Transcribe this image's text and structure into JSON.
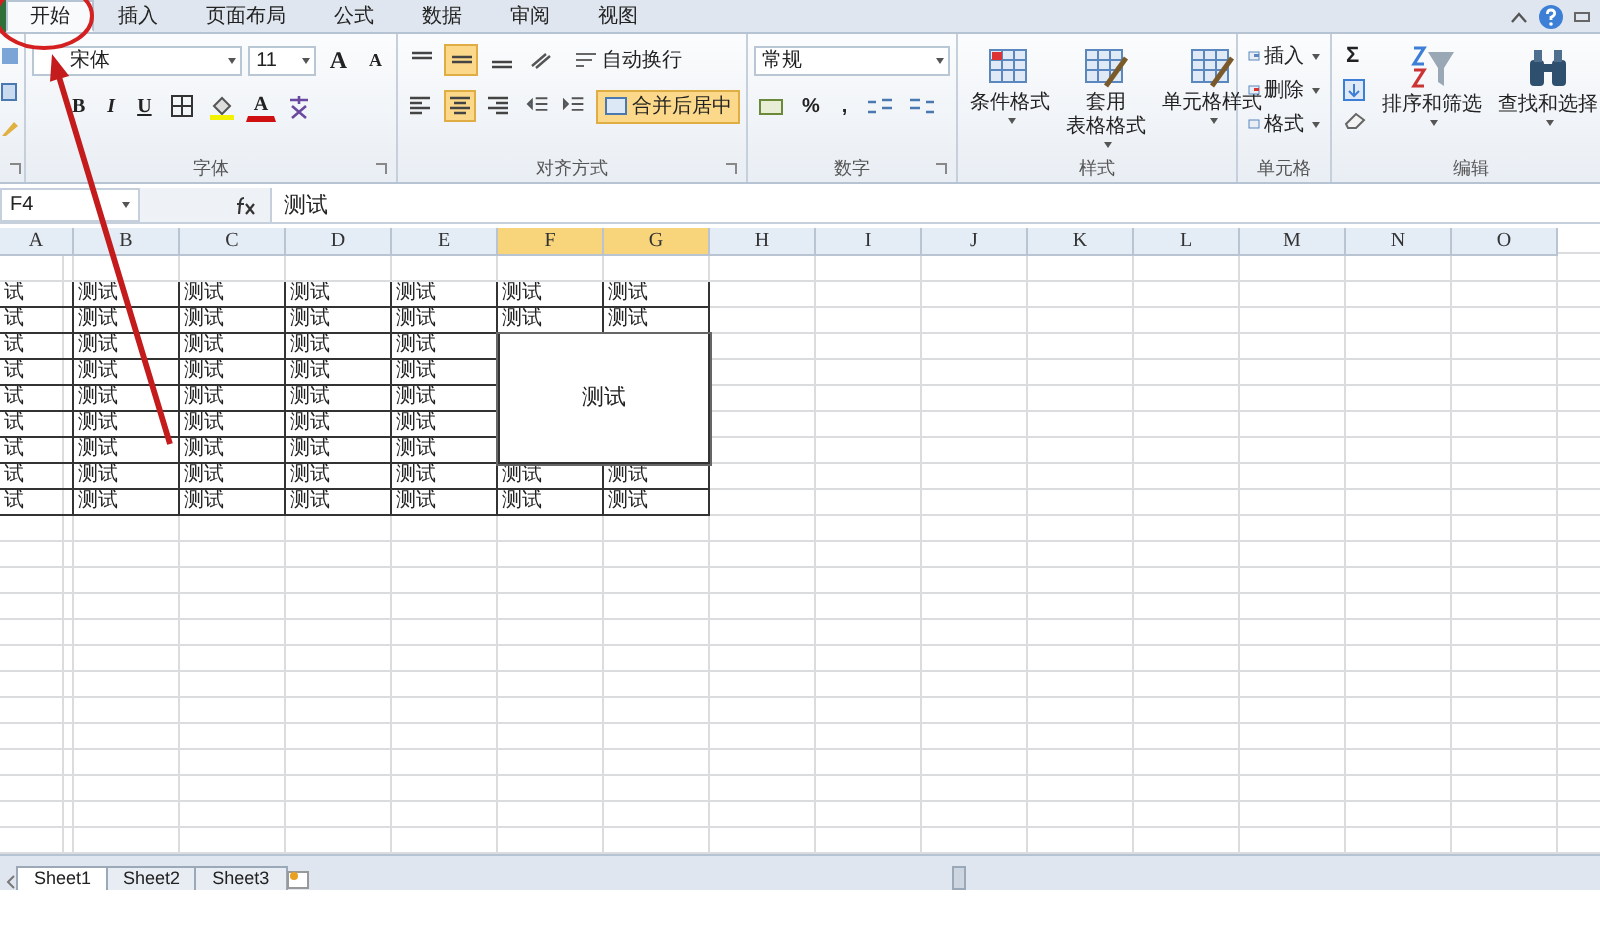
{
  "tabs": [
    {
      "label": "开始",
      "selected": true
    },
    {
      "label": "插入",
      "selected": false
    },
    {
      "label": "页面布局",
      "selected": false
    },
    {
      "label": "公式",
      "selected": false
    },
    {
      "label": "数据",
      "selected": false
    },
    {
      "label": "审阅",
      "selected": false
    },
    {
      "label": "视图",
      "selected": false
    }
  ],
  "font_group": {
    "label": "字体",
    "font_name": "宋体",
    "font_size": "11",
    "grow_font": "A",
    "shrink_font": "A",
    "style_buttons": [
      "B",
      "I",
      "U"
    ],
    "font_color": "A"
  },
  "alignment_group": {
    "label": "对齐方式",
    "vertical_align": [
      {
        "selected": false
      },
      {
        "selected": true
      },
      {
        "selected": false
      }
    ],
    "horizontal_align": [
      {
        "selected": false
      },
      {
        "selected": true
      },
      {
        "selected": false
      }
    ],
    "wrap_button": "自动换行",
    "merge_button": {
      "label": "合并后居中",
      "selected": true
    }
  },
  "number_group": {
    "label": "数字",
    "format": "常规",
    "percent": "%",
    "comma": ","
  },
  "styles_group": {
    "label": "样式",
    "buttons": [
      {
        "lines": [
          "条件格式"
        ]
      },
      {
        "lines": [
          "套用",
          "表格格式"
        ]
      },
      {
        "lines": [
          "单元格样式"
        ]
      }
    ]
  },
  "cells_group": {
    "label": "单元格",
    "buttons": [
      "插入",
      "删除",
      "格式"
    ]
  },
  "editing_group": {
    "label": "编辑",
    "sum": "Σ",
    "buttons": [
      "排序和筛选",
      "查找和选择"
    ]
  },
  "formula_bar": {
    "name_box": "F4",
    "formula": "测试"
  },
  "grid": {
    "columns": [
      {
        "label": "A",
        "selected": false
      },
      {
        "label": "B",
        "selected": false
      },
      {
        "label": "C",
        "selected": false
      },
      {
        "label": "D",
        "selected": false
      },
      {
        "label": "E",
        "selected": false
      },
      {
        "label": "F",
        "selected": true
      },
      {
        "label": "G",
        "selected": true
      },
      {
        "label": "H",
        "selected": false
      },
      {
        "label": "I",
        "selected": false
      },
      {
        "label": "J",
        "selected": false
      },
      {
        "label": "K",
        "selected": false
      },
      {
        "label": "L",
        "selected": false
      },
      {
        "label": "M",
        "selected": false
      },
      {
        "label": "N",
        "selected": false
      },
      {
        "label": "O",
        "selected": false
      }
    ],
    "rows": [
      {
        "cells": []
      },
      {
        "cells": [
          "试",
          "测试",
          "测试",
          "测试",
          "测试",
          "测试",
          "测试"
        ]
      },
      {
        "cells": [
          "试",
          "测试",
          "测试",
          "测试",
          "测试",
          "测试",
          "测试"
        ]
      },
      {
        "cells": [
          "试",
          "测试",
          "测试",
          "测试",
          "测试"
        ]
      },
      {
        "cells": [
          "试",
          "测试",
          "测试",
          "测试",
          "测试"
        ]
      },
      {
        "cells": [
          "试",
          "测试",
          "测试",
          "测试",
          "测试"
        ]
      },
      {
        "cells": [
          "试",
          "测试",
          "测试",
          "测试",
          "测试"
        ]
      },
      {
        "cells": [
          "试",
          "测试",
          "测试",
          "测试",
          "测试"
        ]
      },
      {
        "cells": [
          "试",
          "测试",
          "测试",
          "测试",
          "测试",
          "测试",
          "测试"
        ]
      },
      {
        "cells": [
          "试",
          "测试",
          "测试",
          "测试",
          "测试",
          "测试",
          "测试"
        ]
      }
    ],
    "merged_cell": {
      "text": "测试"
    }
  },
  "sheet_tabs": [
    {
      "label": "Sheet1",
      "selected": true
    },
    {
      "label": "Sheet2",
      "selected": false
    },
    {
      "label": "Sheet3",
      "selected": false
    }
  ]
}
